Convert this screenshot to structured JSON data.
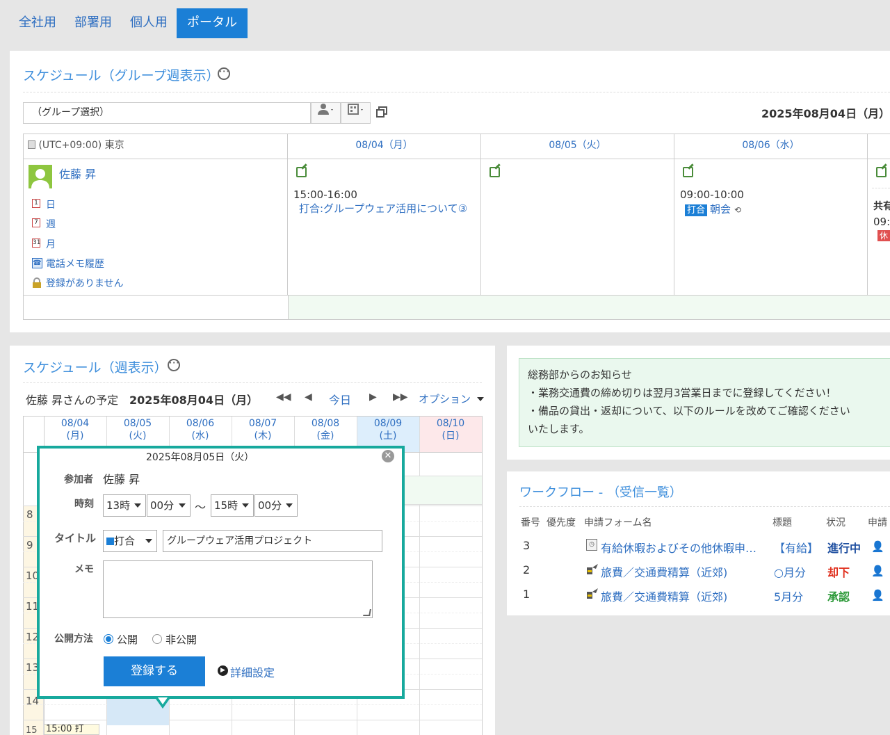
{
  "tabs": [
    {
      "label": "全社用"
    },
    {
      "label": "部署用"
    },
    {
      "label": "個人用"
    },
    {
      "label": "ポータル"
    }
  ],
  "group_schedule": {
    "title": "スケジュール（グループ週表示）",
    "group_select_placeholder": "（グループ選択）",
    "date_heading": "2025年08月04日（月）",
    "timezone": "(UTC+09:00) 東京",
    "days": [
      {
        "label": "08/04（月）"
      },
      {
        "label": "08/05（火）"
      },
      {
        "label": "08/06（水）"
      }
    ],
    "user_name": "佐藤 昇",
    "user_links": [
      {
        "icon": "1",
        "label": "日"
      },
      {
        "icon": "7",
        "label": "週"
      },
      {
        "icon": "31",
        "label": "月"
      },
      {
        "icon": "phone-icon",
        "label": "電話メモ履歴"
      },
      {
        "icon": "lock-icon",
        "label": "登録がありません"
      }
    ],
    "events": {
      "mon": {
        "time": "15:00-16:00",
        "title": "打合:グループウェア活用について③"
      },
      "wed": {
        "time": "09:00-10:00",
        "badge": "打合",
        "title": "朝会"
      },
      "thu_partial": {
        "label": "共有",
        "time": "09:",
        "badge": "休"
      }
    }
  },
  "week_schedule": {
    "title": "スケジュール（週表示）",
    "owner_text": "佐藤 昇さんの予定",
    "date": "2025年08月04日（月）",
    "today_label": "今日",
    "option_label": "オプション",
    "days": [
      {
        "date": "08/04",
        "dow": "(月)"
      },
      {
        "date": "08/05",
        "dow": "(火)"
      },
      {
        "date": "08/06",
        "dow": "(水)"
      },
      {
        "date": "08/07",
        "dow": "(木)"
      },
      {
        "date": "08/08",
        "dow": "(金)"
      },
      {
        "date": "08/09",
        "dow": "(土)"
      },
      {
        "date": "08/10",
        "dow": "(日)"
      }
    ],
    "hours": [
      "8",
      "9",
      "10",
      "11",
      "12",
      "13",
      "14",
      "15"
    ],
    "bottom_event": "15:00 打"
  },
  "popup": {
    "date": "2025年08月05日（火）",
    "participant_label": "参加者",
    "participant": "佐藤 昇",
    "time_label": "時刻",
    "start_hour": "13時",
    "start_min": "00分",
    "tilde": "～",
    "end_hour": "15時",
    "end_min": "00分",
    "title_label": "タイトル",
    "category": "打合",
    "title_value": "グループウェア活用プロジェクト",
    "memo_label": "メモ",
    "publish_label": "公開方法",
    "public": "公開",
    "private": "非公開",
    "submit": "登録する",
    "detail": "詳細設定",
    "colors": {
      "border": "#17a99d",
      "button": "#1b7fd6"
    }
  },
  "notice": {
    "lines": [
      "総務部からのお知らせ",
      "・業務交通費の締め切りは翌月3営業日までに登録してください！",
      "・備品の貸出・返却について、以下のルールを改めてご確認ください",
      "いたします。"
    ]
  },
  "workflow": {
    "title": "ワークフロー - （受信一覧）",
    "headers": [
      "番号",
      "優先度",
      "申請フォーム名",
      "標題",
      "状況",
      "申請"
    ],
    "rows": [
      {
        "no": "3",
        "form": "有給休暇およびその他休暇申…",
        "subject": "【有給】",
        "status": "進行中",
        "status_color": "#1f4fa0"
      },
      {
        "no": "2",
        "form": "旅費／交通費精算（近郊)",
        "subject": "○月分",
        "status": "却下",
        "status_color": "#e0301e"
      },
      {
        "no": "1",
        "form": "旅費／交通費精算（近郊)",
        "subject": "5月分",
        "status": "承認",
        "status_color": "#2e9a3a"
      }
    ]
  }
}
